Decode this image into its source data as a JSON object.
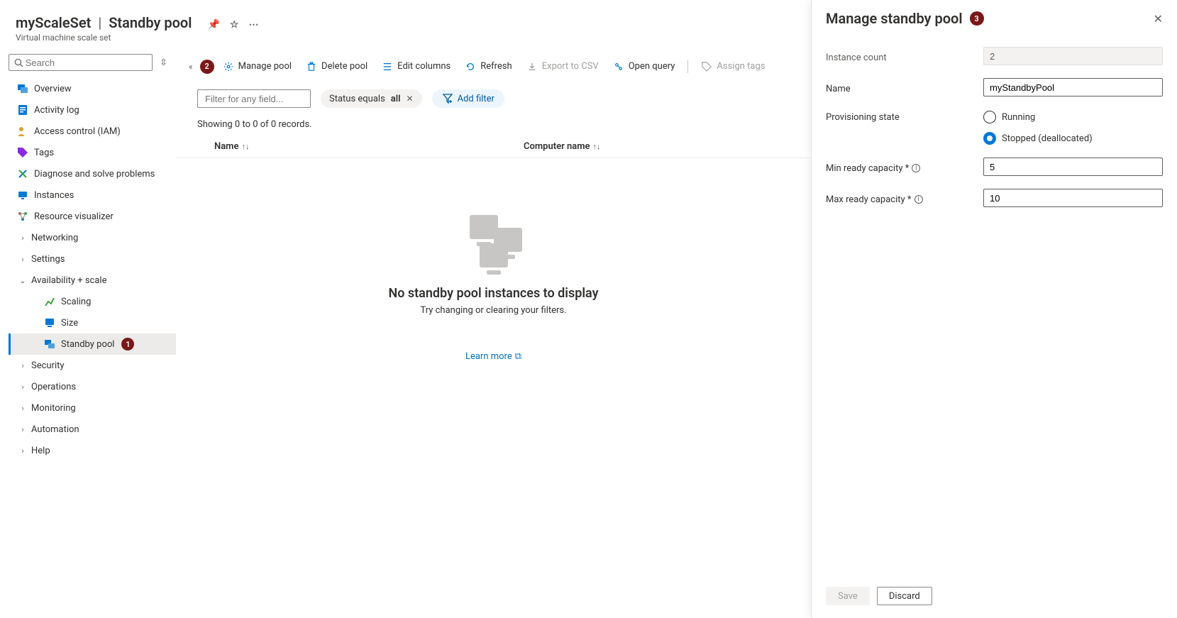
{
  "header": {
    "resource_name": "myScaleSet",
    "blade_name": "Standby pool",
    "subtitle": "Virtual machine scale set"
  },
  "search": {
    "placeholder": "Search"
  },
  "nav": {
    "overview": "Overview",
    "activity_log": "Activity log",
    "access_control": "Access control (IAM)",
    "tags": "Tags",
    "diagnose": "Diagnose and solve problems",
    "instances": "Instances",
    "resource_visualizer": "Resource visualizer",
    "networking": "Networking",
    "settings": "Settings",
    "availability_scale": "Availability + scale",
    "scaling": "Scaling",
    "size": "Size",
    "standby_pool": "Standby pool",
    "standby_pool_badge": "1",
    "security": "Security",
    "operations": "Operations",
    "monitoring": "Monitoring",
    "automation": "Automation",
    "help": "Help"
  },
  "toolbar": {
    "manage_pool": "Manage pool",
    "manage_pool_badge": "2",
    "delete_pool": "Delete pool",
    "edit_columns": "Edit columns",
    "refresh": "Refresh",
    "export_csv": "Export to CSV",
    "open_query": "Open query",
    "assign_tags": "Assign tags"
  },
  "filters": {
    "field_placeholder": "Filter for any field...",
    "status_pill_prefix": "Status equals ",
    "status_pill_value": "all",
    "add_filter": "Add filter"
  },
  "records_text": "Showing 0 to 0 of 0 records.",
  "grid": {
    "col_name": "Name",
    "col_computer": "Computer name"
  },
  "empty": {
    "title": "No standby pool instances to display",
    "subtitle": "Try changing or clearing your filters.",
    "learn_more": "Learn more"
  },
  "flyout": {
    "title": "Manage standby pool",
    "title_badge": "3",
    "instance_count_label": "Instance count",
    "instance_count_value": "2",
    "name_label": "Name",
    "name_value": "myStandbyPool",
    "prov_state_label": "Provisioning state",
    "prov_running": "Running",
    "prov_stopped": "Stopped (deallocated)",
    "min_ready_label": "Min ready capacity *",
    "min_ready_value": "5",
    "max_ready_label": "Max ready capacity *",
    "max_ready_value": "10",
    "save": "Save",
    "discard": "Discard"
  }
}
